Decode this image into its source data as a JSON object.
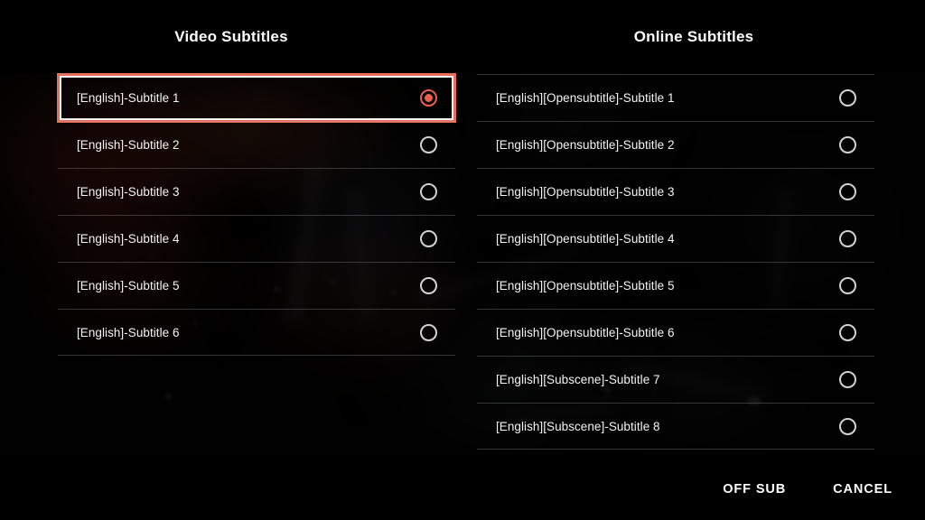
{
  "dialog": {
    "name": "subtitle-selection-dialog"
  },
  "columns": [
    {
      "id": "video-subtitles",
      "title": "Video Subtitles",
      "items": [
        {
          "label": "[English]-Subtitle 1",
          "selected": true,
          "radio_icon": "radio-selected-icon"
        },
        {
          "label": "[English]-Subtitle 2",
          "selected": false,
          "radio_icon": "radio-unselected-icon"
        },
        {
          "label": "[English]-Subtitle 3",
          "selected": false,
          "radio_icon": "radio-unselected-icon"
        },
        {
          "label": "[English]-Subtitle 4",
          "selected": false,
          "radio_icon": "radio-unselected-icon"
        },
        {
          "label": "[English]-Subtitle 5",
          "selected": false,
          "radio_icon": "radio-unselected-icon"
        },
        {
          "label": "[English]-Subtitle 6",
          "selected": false,
          "radio_icon": "radio-unselected-icon"
        }
      ]
    },
    {
      "id": "online-subtitles",
      "title": "Online Subtitles",
      "items": [
        {
          "label": "[English][Opensubtitle]-Subtitle 1",
          "selected": false,
          "radio_icon": "radio-unselected-icon"
        },
        {
          "label": "[English][Opensubtitle]-Subtitle 2",
          "selected": false,
          "radio_icon": "radio-unselected-icon"
        },
        {
          "label": "[English][Opensubtitle]-Subtitle 3",
          "selected": false,
          "radio_icon": "radio-unselected-icon"
        },
        {
          "label": "[English][Opensubtitle]-Subtitle 4",
          "selected": false,
          "radio_icon": "radio-unselected-icon"
        },
        {
          "label": "[English][Opensubtitle]-Subtitle 5",
          "selected": false,
          "radio_icon": "radio-unselected-icon"
        },
        {
          "label": "[English][Opensubtitle]-Subtitle 6",
          "selected": false,
          "radio_icon": "radio-unselected-icon"
        },
        {
          "label": "[English][Subscene]-Subtitle 7",
          "selected": false,
          "radio_icon": "radio-unselected-icon"
        },
        {
          "label": "[English][Subscene]-Subtitle 8",
          "selected": false,
          "radio_icon": "radio-unselected-icon"
        }
      ]
    }
  ],
  "actions": [
    {
      "id": "off-sub",
      "label": "OFF SUB"
    },
    {
      "id": "cancel",
      "label": "CANCEL"
    }
  ],
  "colors": {
    "background": "#000000",
    "text_primary": "#f4f4f4",
    "title": "#fdfdfd",
    "focus_outer": "#e96d5c",
    "focus_inner": "#f2f2f2",
    "radio_selected": "#e8604f",
    "radio_unselected": "#d2d2d4",
    "divider": "rgba(168,168,172,0.30)"
  }
}
